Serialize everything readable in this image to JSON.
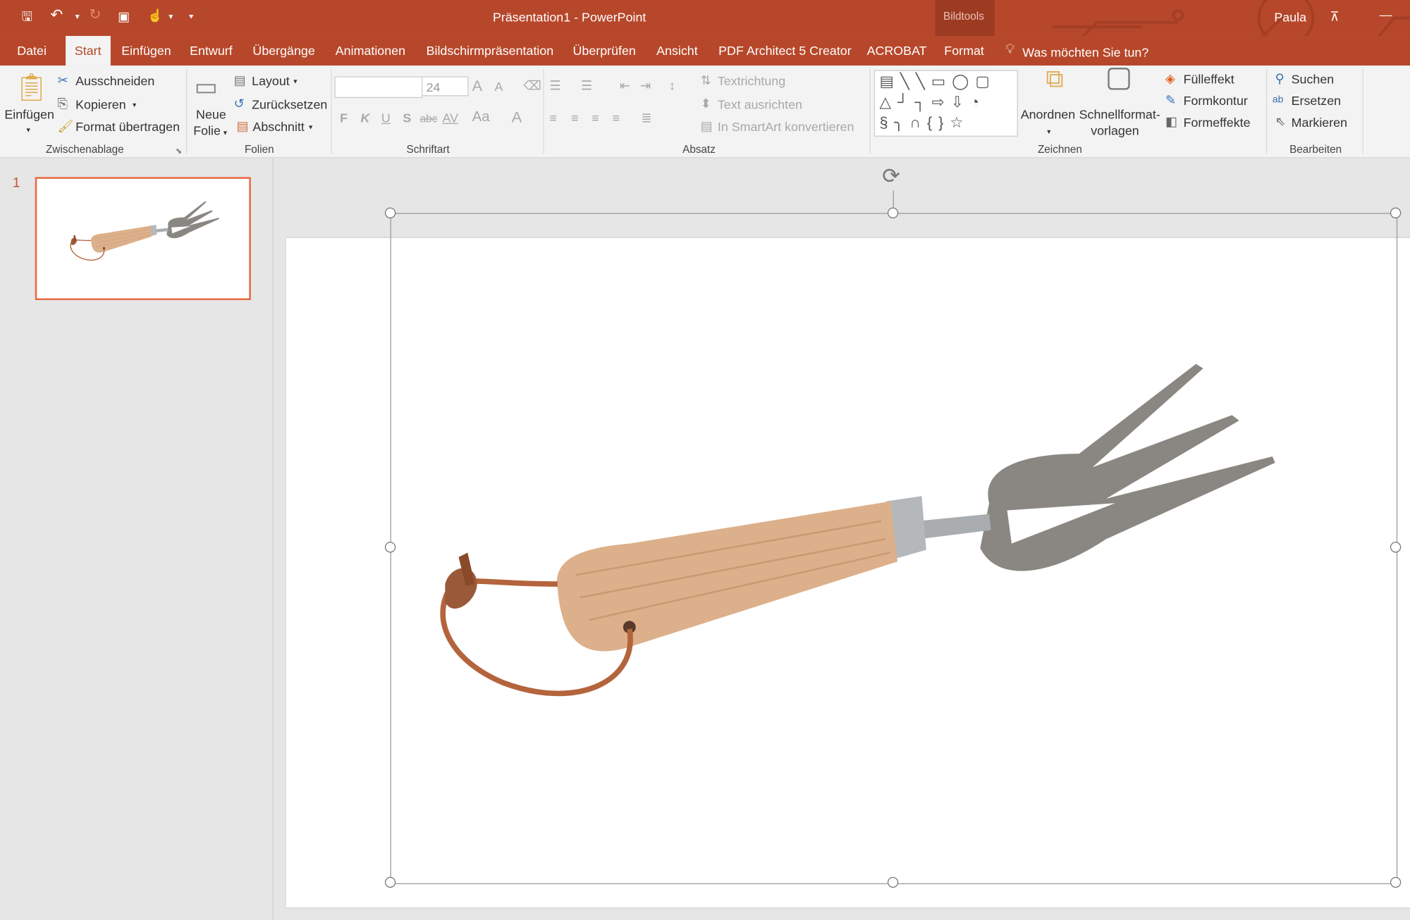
{
  "titlebar": {
    "title": "Präsentation1  -  PowerPoint",
    "context_group": "Bildtools",
    "user": "Paula"
  },
  "tabs": [
    "Datei",
    "Start",
    "Einfügen",
    "Entwurf",
    "Übergänge",
    "Animationen",
    "Bildschirmpräsentation",
    "Überprüfen",
    "Ansicht",
    "PDF Architect 5 Creator",
    "ACROBAT",
    "Format"
  ],
  "active_tab": "Start",
  "tell_me": "Was möchten Sie tun?",
  "ribbon": {
    "clipboard": {
      "paste": "Einfügen",
      "cut": "Ausschneiden",
      "copy": "Kopieren",
      "format_painter": "Format übertragen",
      "label": "Zwischenablage"
    },
    "slides": {
      "new_slide_1": "Neue",
      "new_slide_2": "Folie",
      "layout": "Layout",
      "reset": "Zurücksetzen",
      "section": "Abschnitt",
      "label": "Folien"
    },
    "font": {
      "font_name": "",
      "font_size": "24",
      "bold": "F",
      "italic": "K",
      "underline": "U",
      "shadow": "S",
      "strike": "abc",
      "spacing": "AV",
      "case": "Aa",
      "color": "A",
      "grow": "A",
      "shrink": "A",
      "label": "Schriftart"
    },
    "paragraph": {
      "text_direction": "Textrichtung",
      "align_text": "Text ausrichten",
      "smartart": "In SmartArt konvertieren",
      "label": "Absatz"
    },
    "drawing": {
      "arrange": "Anordnen",
      "quick_styles_1": "Schnellformat-",
      "quick_styles_2": "vorlagen",
      "fill": "Fülleffekt",
      "outline": "Formkontur",
      "effects": "Formeffekte",
      "label": "Zeichnen"
    },
    "editing": {
      "find": "Suchen",
      "replace": "Ersetzen",
      "select": "Markieren",
      "label": "Bearbeiten"
    }
  },
  "slides_pane": {
    "slide_number": "1"
  },
  "colors": {
    "accent": "#b7472a",
    "thumb_border": "#e86a44"
  }
}
